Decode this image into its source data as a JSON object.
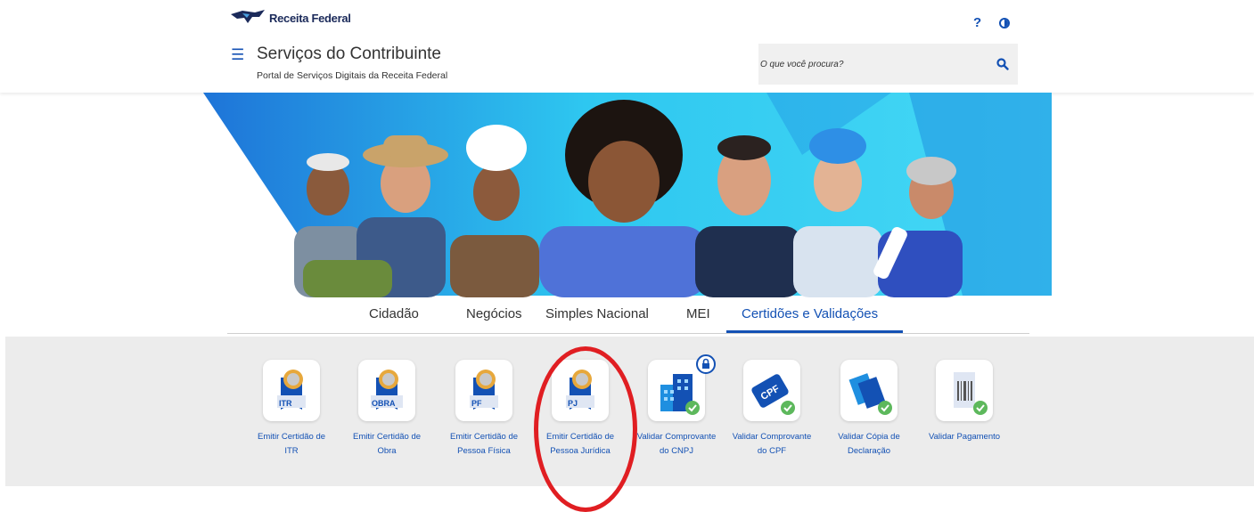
{
  "header": {
    "logo_text": "Receita Federal",
    "menu_icon": "hamburger-icon",
    "title": "Serviços do Contribuinte",
    "subtitle": "Portal de Serviços Digitais da Receita Federal",
    "help_label": "?",
    "contrast_icon": "contrast-icon"
  },
  "search": {
    "placeholder": "O que você procura?",
    "icon": "search-icon"
  },
  "tabs": [
    {
      "label": "Cidadão"
    },
    {
      "label": "Negócios"
    },
    {
      "label": "Simples Nacional"
    },
    {
      "label": "MEI"
    },
    {
      "label": "Certidões e Validações",
      "active": true
    }
  ],
  "services": [
    {
      "label": "Emitir Certidão de ITR",
      "badge": "ITR",
      "icon": "certificate-ribbon-icon"
    },
    {
      "label": "Emitir Certidão de Obra",
      "badge": "OBRA",
      "icon": "certificate-ribbon-icon"
    },
    {
      "label": "Emitir Certidão de Pessoa Física",
      "badge": "PF",
      "icon": "certificate-ribbon-icon"
    },
    {
      "label": "Emitir Certidão de Pessoa Jurídica",
      "badge": "PJ",
      "icon": "certificate-ribbon-icon",
      "highlighted": true
    },
    {
      "label": "Validar Comprovante do CNPJ",
      "icon": "building-check-icon",
      "locked": true
    },
    {
      "label": "Validar Comprovante do CPF",
      "badge": "CPF",
      "icon": "cpf-card-check-icon"
    },
    {
      "label": "Validar Cópia de Declaração",
      "icon": "documents-check-icon"
    },
    {
      "label": "Validar Pagamento",
      "icon": "barcode-check-icon"
    }
  ],
  "colors": {
    "brand_blue": "#1351b4",
    "navy": "#1b2a5a",
    "highlight_red": "#e01e22",
    "banner_cyan": "#2ec7f0",
    "panel_gray": "#ececec"
  }
}
